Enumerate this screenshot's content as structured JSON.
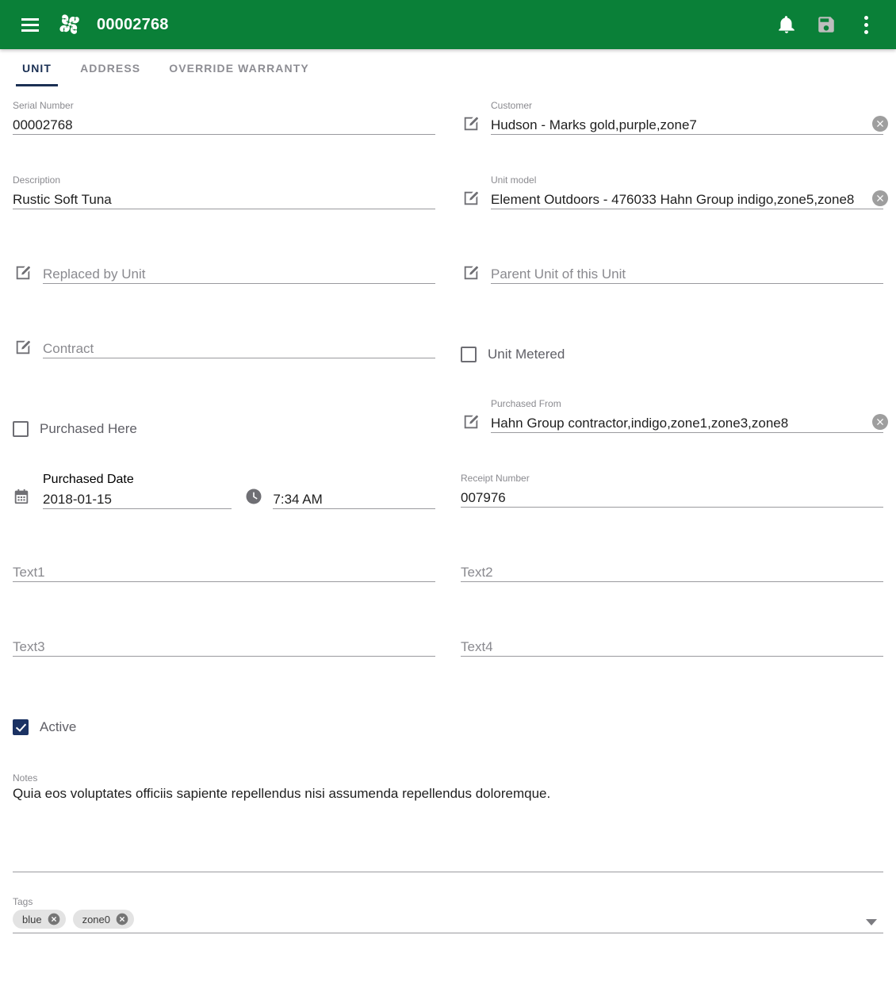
{
  "appbar": {
    "menu_icon": "hamburger-menu-icon",
    "logo_icon": "pinwheel-logo-icon",
    "title": "00002768",
    "notifications_icon": "bell-icon",
    "save_icon": "save-disk-icon",
    "overflow_icon": "more-vertical-icon",
    "background_color": "#0a8038"
  },
  "tabs": [
    {
      "label": "UNIT",
      "active": true
    },
    {
      "label": "ADDRESS",
      "active": false
    },
    {
      "label": "OVERRIDE WARRANTY",
      "active": false
    }
  ],
  "accent_color": "#1b3054",
  "fields": {
    "serial_number": {
      "label": "Serial Number",
      "value": "00002768"
    },
    "customer": {
      "label": "Customer",
      "value": "Hudson - Marks gold,purple,zone7",
      "edit_icon": "edit-square-icon",
      "clear_icon": "clear-circle-icon"
    },
    "description": {
      "label": "Description",
      "value": "Rustic Soft Tuna"
    },
    "unit_model": {
      "label": "Unit model",
      "value": "Element Outdoors - 476033 Hahn Group indigo,zone5,zone8",
      "edit_icon": "edit-square-icon",
      "clear_icon": "clear-circle-icon"
    },
    "replaced_by_unit": {
      "placeholder": "Replaced by Unit",
      "value": "",
      "edit_icon": "edit-square-icon"
    },
    "parent_unit": {
      "placeholder": "Parent Unit of this Unit",
      "value": "",
      "edit_icon": "edit-square-icon"
    },
    "contract": {
      "placeholder": "Contract",
      "value": "",
      "edit_icon": "edit-square-icon"
    },
    "unit_metered": {
      "label": "Unit Metered",
      "checked": false
    },
    "purchased_here": {
      "label": "Purchased Here",
      "checked": false
    },
    "purchased_from": {
      "label": "Purchased From",
      "value": "Hahn Group contractor,indigo,zone1,zone3,zone8",
      "edit_icon": "edit-square-icon",
      "clear_icon": "clear-circle-icon"
    },
    "purchased_date": {
      "label": "Purchased Date",
      "value": "2018-01-15",
      "icon": "calendar-icon"
    },
    "purchased_time": {
      "label": "",
      "value": "7:34 AM",
      "icon": "clock-icon"
    },
    "receipt_number": {
      "label": "Receipt Number",
      "value": "007976"
    },
    "text1": {
      "placeholder": "Text1",
      "value": ""
    },
    "text2": {
      "placeholder": "Text2",
      "value": ""
    },
    "text3": {
      "placeholder": "Text3",
      "value": ""
    },
    "text4": {
      "placeholder": "Text4",
      "value": ""
    },
    "active": {
      "label": "Active",
      "checked": true,
      "checked_color": "#1b3263"
    },
    "notes": {
      "label": "Notes",
      "value": "Quia eos voluptates officiis sapiente repellendus nisi assumenda repellendus doloremque."
    },
    "tags": {
      "label": "Tags",
      "chips": [
        {
          "label": "blue",
          "remove_icon": "chip-remove-icon"
        },
        {
          "label": "zone0",
          "remove_icon": "chip-remove-icon"
        }
      ],
      "caret_icon": "dropdown-caret-icon"
    }
  }
}
